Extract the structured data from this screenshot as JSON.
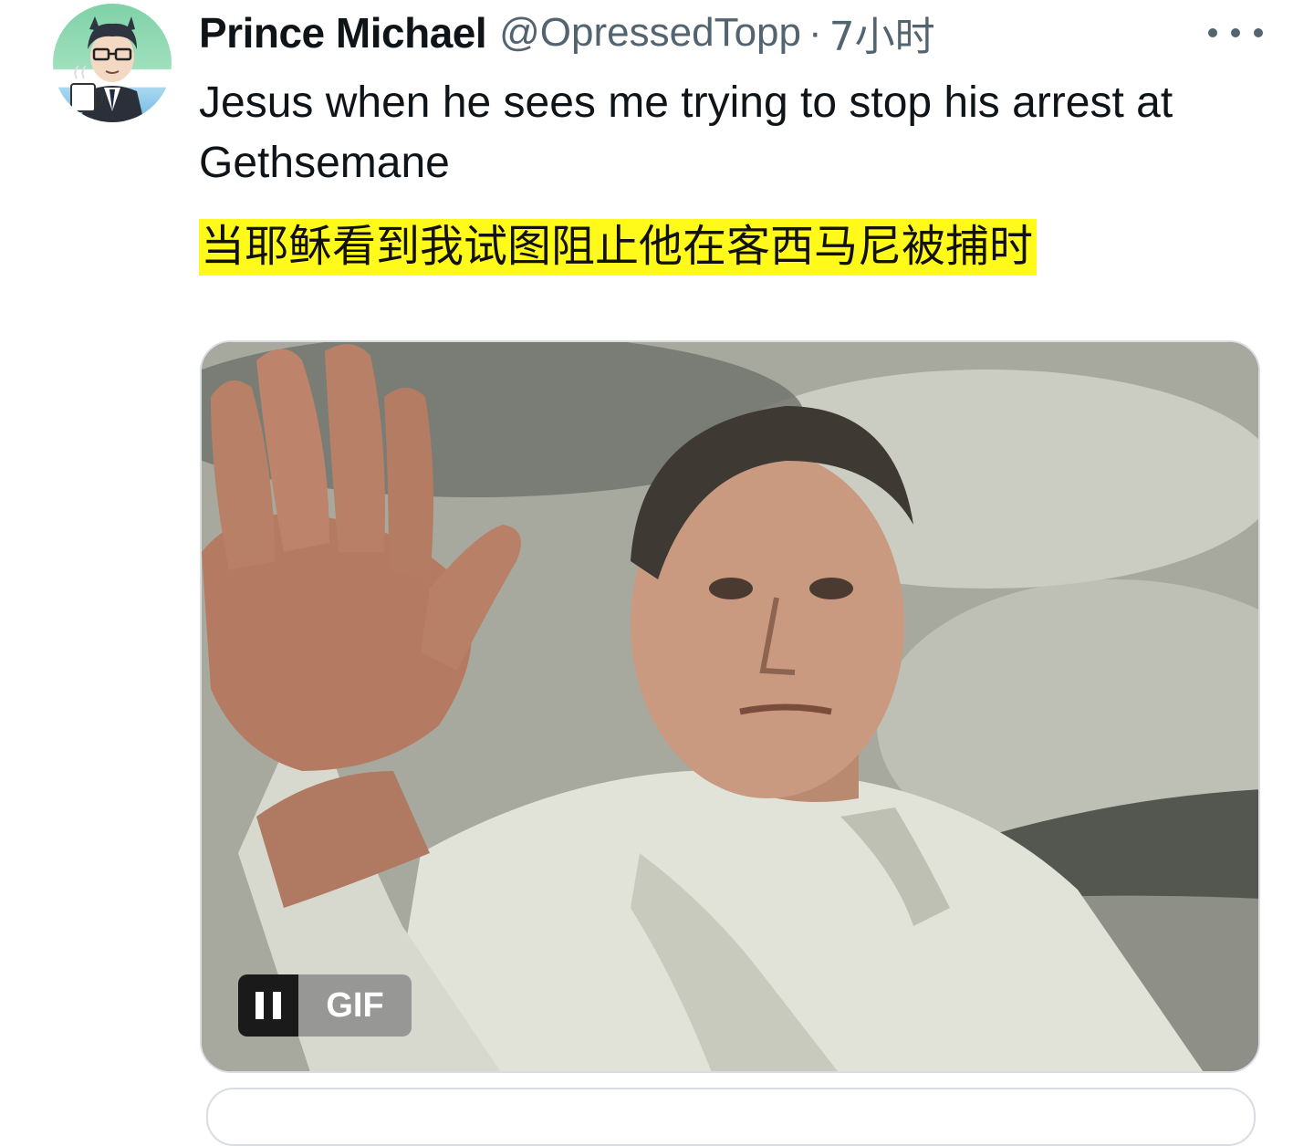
{
  "author": {
    "display_name": "Prince Michael",
    "handle": "@OpressedTopp",
    "separator": "·",
    "time": "7小时",
    "avatar_icon": "avatar-illustration"
  },
  "menu_icon": "more-horizontal-icon",
  "tweet": {
    "text": "Jesus when he sees me trying to stop his arrest at Gethsemane",
    "translation": "当耶稣看到我试图阻止他在客西马尼被捕时",
    "translation_highlight": "#fffa1a"
  },
  "media": {
    "type": "gif",
    "badge_label": "GIF",
    "pause_icon": "pause-icon"
  },
  "colors": {
    "text_primary": "#0f1419",
    "text_secondary": "#536471",
    "border": "#d9dde1"
  }
}
